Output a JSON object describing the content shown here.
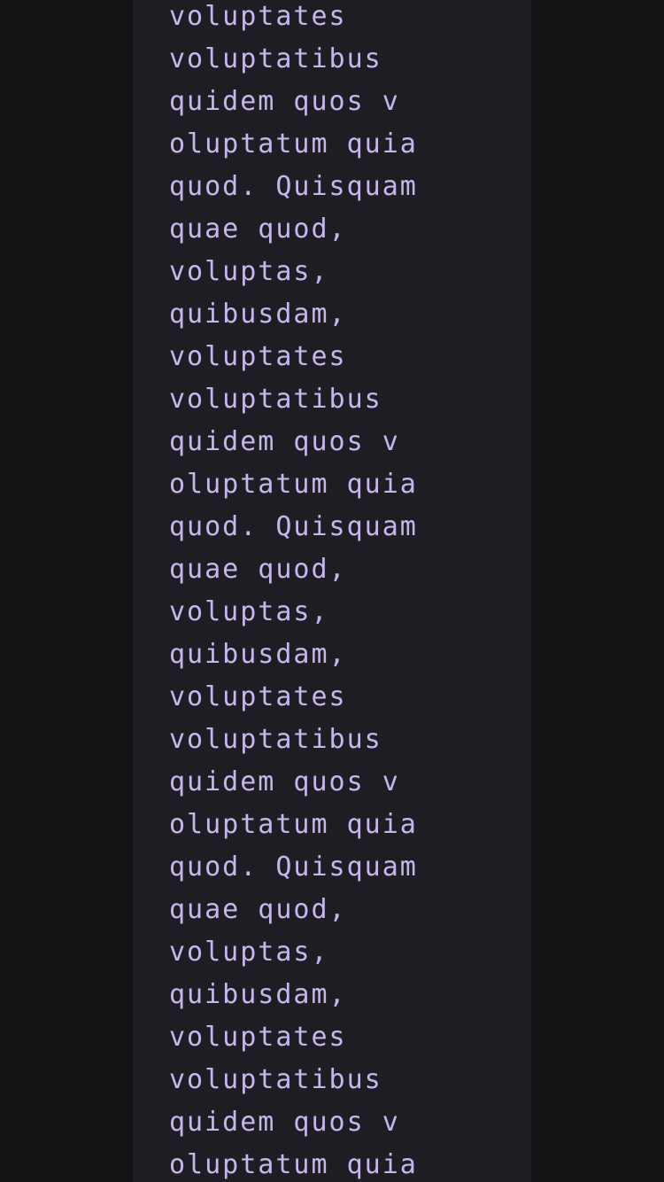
{
  "content": {
    "lines": [
      "voluptates",
      "voluptatibus",
      "quidem quos v",
      "oluptatum quia",
      "quod. Quisquam",
      "quae quod,",
      "voluptas,",
      "quibusdam,",
      "voluptates",
      "voluptatibus",
      "quidem quos v",
      "oluptatum quia",
      "quod. Quisquam",
      "quae quod,",
      "voluptas,",
      "quibusdam,",
      "voluptates",
      "voluptatibus",
      "quidem quos v",
      "oluptatum quia",
      "quod. Quisquam",
      "quae quod,",
      "voluptas,",
      "quibusdam,",
      "voluptates",
      "voluptatibus",
      "quidem quos v",
      "oluptatum quia"
    ]
  },
  "colors": {
    "page_background": "#131316",
    "panel_background": "#1e1d23",
    "text": "#c6b6ec"
  }
}
